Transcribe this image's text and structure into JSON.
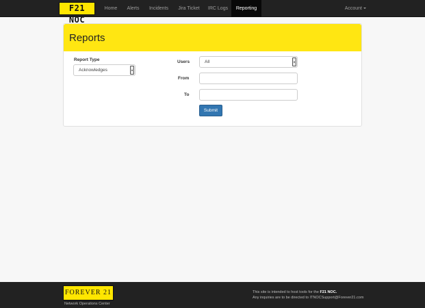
{
  "navbar": {
    "brand": "F21 NOC",
    "items": [
      {
        "label": "Home"
      },
      {
        "label": "Alerts"
      },
      {
        "label": "Incidents"
      },
      {
        "label": "Jira Ticket"
      },
      {
        "label": "IRC Logs"
      },
      {
        "label": "Reporting",
        "active": true
      }
    ],
    "account_label": "Account"
  },
  "panel": {
    "title": "Reports"
  },
  "form": {
    "report_type_label": "Report Type",
    "report_type_value": "Acknowledges",
    "users_label": "Users",
    "users_value": "All",
    "from_label": "From",
    "from_value": "",
    "to_label": "To",
    "to_value": "",
    "submit_label": "Submit"
  },
  "footer": {
    "logo_text": "FOREVER 21",
    "logo_caption": "Network Operations Center",
    "line1_prefix": "This site is intended to host tools for the ",
    "line1_bold": "F21 NOC.",
    "line2": "Any inquiries are to be directed to ITNOCSupport@Forever21.com"
  },
  "colors": {
    "brand_yellow": "#ffe600",
    "navbar_bg": "#222222",
    "submit_blue": "#3276b1"
  }
}
